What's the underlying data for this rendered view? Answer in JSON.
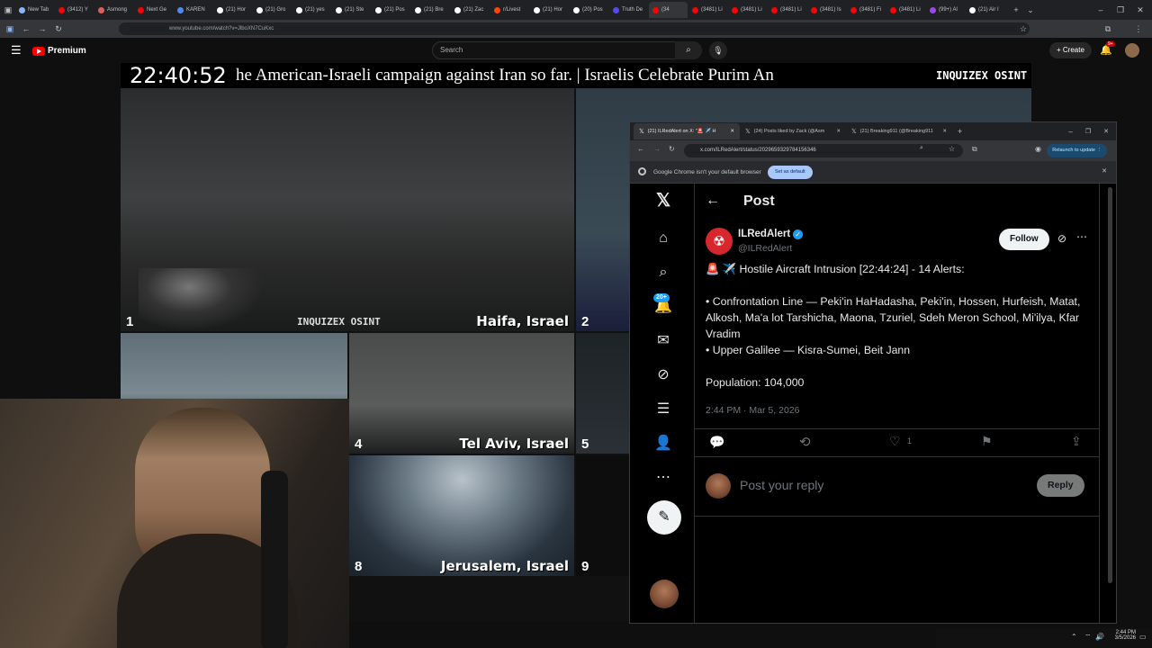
{
  "outer_browser": {
    "tabs": [
      {
        "label": "New Tab",
        "color": "#8ab4f8"
      },
      {
        "label": "(3412) Y",
        "color": "#ff0000"
      },
      {
        "label": "Asmong",
        "color": "#e05d5d"
      },
      {
        "label": "Next Ge",
        "color": "#ff0000"
      },
      {
        "label": "KAREN",
        "color": "#4c8bf5"
      },
      {
        "label": "(21) Hor",
        "color": "#ffffff"
      },
      {
        "label": "(21) Gro",
        "color": "#ffffff"
      },
      {
        "label": "(21) yes",
        "color": "#ffffff"
      },
      {
        "label": "(21) Ste",
        "color": "#ffffff"
      },
      {
        "label": "(21) Pos",
        "color": "#ffffff"
      },
      {
        "label": "(21) Bre",
        "color": "#ffffff"
      },
      {
        "label": "(21) Zac",
        "color": "#ffffff"
      },
      {
        "label": "r/Livest",
        "color": "#ff4500"
      },
      {
        "label": "(21) Hor",
        "color": "#ffffff"
      },
      {
        "label": "(20) Pos",
        "color": "#ffffff"
      },
      {
        "label": "Truth De",
        "color": "#5448ee"
      },
      {
        "label": "(34",
        "color": "#ff0000"
      },
      {
        "label": "(3481) Li",
        "color": "#ff0000"
      },
      {
        "label": "(3481) Li",
        "color": "#ff0000"
      },
      {
        "label": "(3481) Li",
        "color": "#ff0000"
      },
      {
        "label": "(3481) Is",
        "color": "#ff0000"
      },
      {
        "label": "(3481) Fi",
        "color": "#ff0000"
      },
      {
        "label": "(3481) Li",
        "color": "#ff0000"
      },
      {
        "label": "(99+) Al",
        "color": "#a142f4"
      },
      {
        "label": "(21) Air I",
        "color": "#ffffff"
      }
    ],
    "active_tab_index": 16,
    "url": "www.youtube.com/watch?v=JlboXN7CuKxc"
  },
  "youtube": {
    "logo": "Premium",
    "search_placeholder": "Search",
    "create_label": "Create",
    "notif_badge": "9+"
  },
  "stream": {
    "clock": "22:40:52",
    "ticker": "he American-Israeli campaign against Iran so far.    |    Israelis Celebrate Purim An",
    "brand": "INQUIZEX OSINT",
    "cams": [
      {
        "num": "1",
        "label": "Haifa, Israel"
      },
      {
        "num": "2",
        "label": ""
      },
      {
        "num": "4",
        "label": "Tel Aviv, Israel"
      },
      {
        "num": "5",
        "label": ""
      },
      {
        "num": "8",
        "label": "Jerusalem, Israel"
      },
      {
        "num": "9",
        "label": ""
      }
    ],
    "cam1_brand": "INQUIZEX OSINT"
  },
  "popup": {
    "tabs": [
      "(21) ILRedAlert on X: \"🚨 ✈️ H",
      "(24) Posts liked by Zack (@Asm",
      "(21) Breaking911 (@Breaking911"
    ],
    "url": "x.com/ILRedAlert/status/2029659329784156346",
    "relaunch_label": "Relaunch to update",
    "info_text": "Google Chrome isn't your default browser",
    "set_default_label": "Set as default"
  },
  "x": {
    "header_title": "Post",
    "notif_badge": "20+",
    "author_name": "ILRedAlert",
    "author_handle": "@ILRedAlert",
    "follow_label": "Follow",
    "post_lines": [
      "🚨 ✈️ Hostile Aircraft Intrusion [22:44:24] - 14 Alerts:",
      "",
      "• Confrontation Line — Peki'in HaHadasha, Peki'in, Hossen, Hurfeish, Matat, Alkosh, Ma'a lot Tarshicha, Maona, Tzuriel, Sdeh Meron School, Mi'ilya, Kfar Vradim",
      "• Upper Galilee — Kisra-Sumei, Beit Jann",
      "",
      "Population: 104,000"
    ],
    "timestamp": "2:44 PM · Mar 5, 2026",
    "like_count": "1",
    "reply_placeholder": "Post your reply",
    "reply_button": "Reply"
  },
  "taskbar": {
    "time": "2:44 PM",
    "date": "3/5/2026"
  }
}
